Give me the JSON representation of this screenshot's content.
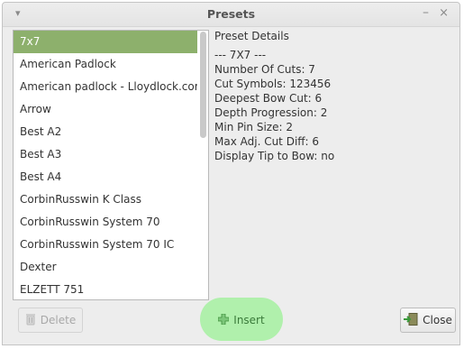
{
  "window": {
    "title": "Presets",
    "menu_glyph": "▾",
    "min_glyph": "–",
    "close_glyph": "×"
  },
  "list": {
    "items": [
      "7x7",
      "American Padlock",
      "American padlock - Lloydlock.com",
      "Arrow",
      "Best A2",
      "Best A3",
      "Best A4",
      "CorbinRusswin K Class",
      "CorbinRusswin System 70",
      "CorbinRusswin System 70 IC",
      "Dexter",
      "ELZETT 751"
    ],
    "selected_index": 0
  },
  "details": {
    "heading": "Preset Details",
    "lines": [
      "--- 7X7 ---",
      "Number Of Cuts: 7",
      "Cut Symbols: 123456",
      "Deepest Bow Cut: 6",
      "Depth Progression: 2",
      "Min Pin Size: 2",
      "Max Adj. Cut Diff: 6",
      "Display Tip to Bow: no"
    ]
  },
  "buttons": {
    "delete_label": "Delete",
    "insert_label": "Insert",
    "close_label": "Close"
  },
  "icons": {
    "delete": "trash-icon",
    "insert": "plus-icon",
    "close": "exit-door-icon"
  },
  "colors": {
    "selection": "#8db06c",
    "insert_highlight": "#a9efa4"
  }
}
